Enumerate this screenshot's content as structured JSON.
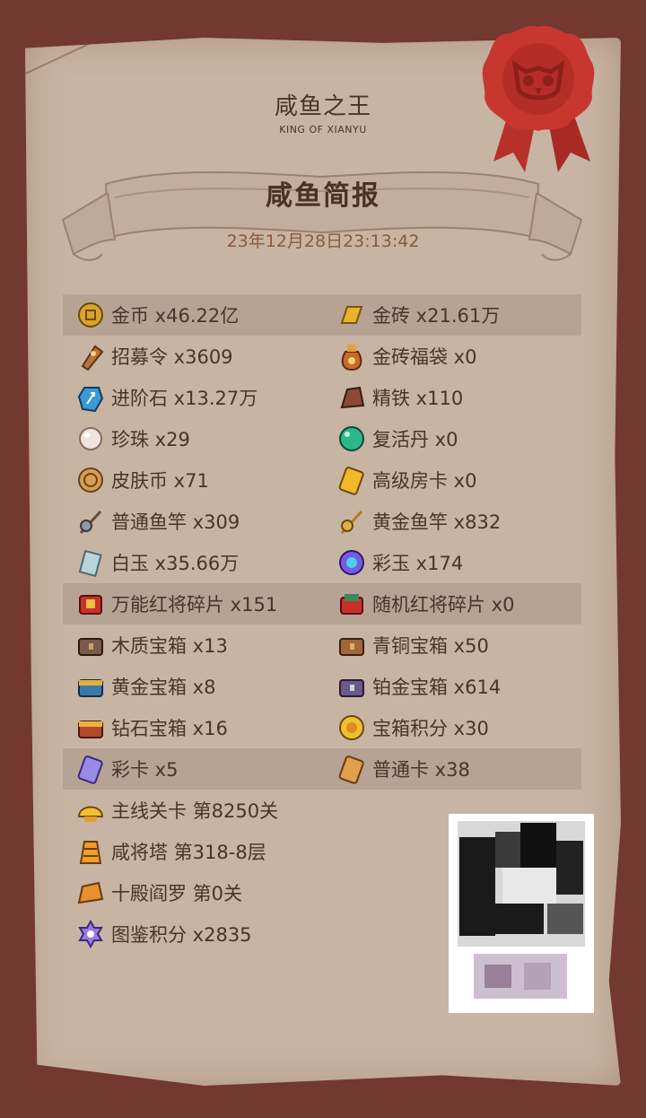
{
  "header": {
    "title": "咸鱼之王",
    "subtitle": "KING OF XIANYU"
  },
  "banner": {
    "title": "咸鱼简报",
    "timestamp": "23年12月28日23:13:42"
  },
  "rows": [
    {
      "highlight": true,
      "left": {
        "icon": "gold-coin-icon",
        "label": "金币 x46.22亿"
      },
      "right": {
        "icon": "gold-brick-icon",
        "label": "金砖 x21.61万"
      }
    },
    {
      "highlight": false,
      "left": {
        "icon": "recruit-token-icon",
        "label": "招募令 x3609"
      },
      "right": {
        "icon": "gold-brick-bag-icon",
        "label": "金砖福袋 x0"
      }
    },
    {
      "highlight": false,
      "left": {
        "icon": "advance-stone-icon",
        "label": "进阶石 x13.27万"
      },
      "right": {
        "icon": "refined-iron-icon",
        "label": "精铁 x110"
      }
    },
    {
      "highlight": false,
      "left": {
        "icon": "pearl-icon",
        "label": "珍珠 x29"
      },
      "right": {
        "icon": "revive-pill-icon",
        "label": "复活丹 x0"
      }
    },
    {
      "highlight": false,
      "left": {
        "icon": "skin-coin-icon",
        "label": "皮肤币 x71"
      },
      "right": {
        "icon": "room-card-icon",
        "label": "高级房卡 x0"
      }
    },
    {
      "highlight": false,
      "left": {
        "icon": "fishing-rod-icon",
        "label": "普通鱼竿 x309"
      },
      "right": {
        "icon": "gold-fishing-rod-icon",
        "label": "黄金鱼竿 x832"
      }
    },
    {
      "highlight": false,
      "left": {
        "icon": "white-jade-icon",
        "label": "白玉 x35.66万"
      },
      "right": {
        "icon": "colored-jade-icon",
        "label": "彩玉 x174"
      }
    },
    {
      "highlight": true,
      "left": {
        "icon": "red-general-fragment-icon",
        "label": "万能红将碎片 x151"
      },
      "right": {
        "icon": "random-red-fragment-icon",
        "label": "随机红将碎片 x0"
      }
    },
    {
      "highlight": false,
      "left": {
        "icon": "wooden-chest-icon",
        "label": "木质宝箱 x13"
      },
      "right": {
        "icon": "bronze-chest-icon",
        "label": "青铜宝箱 x50"
      }
    },
    {
      "highlight": false,
      "left": {
        "icon": "gold-chest-icon",
        "label": "黄金宝箱 x8"
      },
      "right": {
        "icon": "platinum-chest-icon",
        "label": "铂金宝箱 x614"
      }
    },
    {
      "highlight": false,
      "left": {
        "icon": "diamond-chest-icon",
        "label": "钻石宝箱 x16"
      },
      "right": {
        "icon": "chest-points-icon",
        "label": "宝箱积分 x30"
      }
    },
    {
      "highlight": true,
      "left": {
        "icon": "rainbow-card-icon",
        "label": "彩卡 x5"
      },
      "right": {
        "icon": "normal-card-icon",
        "label": "普通卡 x38"
      }
    }
  ],
  "progress": [
    {
      "icon": "main-stage-icon",
      "label": "主线关卡 第8250关"
    },
    {
      "icon": "tower-icon",
      "label": "咸将塔 第318-8层"
    },
    {
      "icon": "yama-icon",
      "label": "十殿阎罗 第0关"
    },
    {
      "icon": "collection-points-icon",
      "label": "图鉴积分 x2835"
    }
  ],
  "colors": {
    "frame": "#73382f",
    "parchment": "#c8b4a3",
    "highlight_row": "#b7a394",
    "text": "#4a3329",
    "timestamp": "#8a5a3a",
    "seal": "#c0392b"
  }
}
